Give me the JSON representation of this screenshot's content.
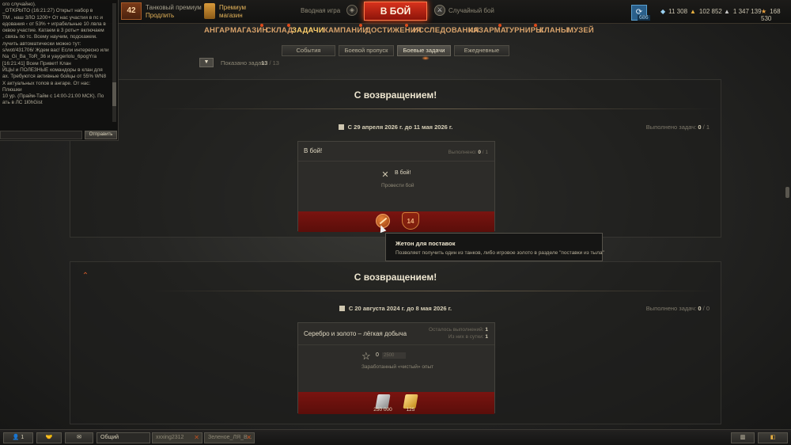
{
  "chat": {
    "lines": [
      "ого случайно).",
      "_OTKPbITO (16:21:27) Открыт набор в",
      "ТМ , наш ЗЛО 1200+ От нас участия в пс и",
      "едования ‹ от 53% + играбельные 10 лвла в",
      "оквое участие. Катаем в 3 роты+ включаем",
      ", связь по тс. Всему научим, подскажем.",
      "лучить автоматически можно тут:",
      "s/wot/431706/ Ждем вас! Если интересно или",
      "Na_Gi_Ba_ToR_36 и yaygerlolu_6pogYra",
      "[16:21:41] Всем Привет! Клан",
      "ЙЦЫ и ПОЛЕЗНЫЕ командоры в клан для",
      "ах. Требуются активные бойцы от 55% WN8",
      "X актуальных топов в ангаре. От нас: Плюшки",
      "10 ур. (Прайм-Тайм с 14:00-21:00 МСК). По",
      "ать в ЛС 1l0hGist"
    ],
    "send_label": "Отправить"
  },
  "topbar": {
    "level": "42",
    "premium_line1": "Танковый премиум",
    "premium_line2": "Продлить",
    "shop_line1": "Премиум",
    "shop_line2": "магазин",
    "mode_left": "Вводная игра",
    "battle_label": "В БОЙ",
    "mode_right": "Случайный бой",
    "garage_count": "686",
    "currencies": [
      {
        "icon": "bonds-icon",
        "value": "11 308"
      },
      {
        "icon": "gold-icon",
        "value": "102 852"
      },
      {
        "icon": "silver-icon",
        "value": "1 347 139"
      },
      {
        "icon": "free-xp-icon",
        "value": "168 530"
      }
    ]
  },
  "nav": {
    "items": [
      {
        "label": "АНГАР",
        "dot": false,
        "active": false
      },
      {
        "label": "МАГАЗИН",
        "dot": true,
        "active": false
      },
      {
        "label": "СКЛАД",
        "dot": true,
        "active": false
      },
      {
        "label": "ЗАДАЧИ",
        "dot": false,
        "active": true
      },
      {
        "label": "КАМПАНИИ",
        "dot": true,
        "active": false
      },
      {
        "label": "ДОСТИЖЕНИЯ",
        "dot": true,
        "active": false
      },
      {
        "label": "ИССЛЕДОВАНИЯ",
        "dot": false,
        "active": false
      },
      {
        "label": "КАЗАРМА",
        "dot": true,
        "active": false
      },
      {
        "label": "ТУРНИРЫ",
        "dot": true,
        "active": false
      },
      {
        "label": "КЛАНЫ",
        "dot": false,
        "active": false
      },
      {
        "label": "МУЗЕЙ",
        "dot": false,
        "active": false
      }
    ]
  },
  "subtabs": [
    {
      "label": "События",
      "active": false
    },
    {
      "label": "Боевой пропуск",
      "active": false
    },
    {
      "label": "Боевые задачи",
      "active": true
    },
    {
      "label": "Ежедневные",
      "active": false
    }
  ],
  "filter": {
    "shown_label": "Показано задач:",
    "shown_value": "13",
    "shown_total": "/ 13"
  },
  "section1": {
    "title": "С возвращением!",
    "dates": "С 29 апреля 2026 г. до 11 мая 2026 г.",
    "progress_label": "Выполнено задач:",
    "progress_done": "0",
    "progress_total": "/ 1",
    "card": {
      "title": "В бой!",
      "progress_label": "Выполнено:",
      "progress_done": "0",
      "progress_total": "/ 1",
      "condition_name": "В бой!",
      "condition_desc": "Провести бой",
      "reward_badge": "14"
    }
  },
  "section2": {
    "title": "С возвращением!",
    "dates": "С 20 августа 2024 г. до 8 мая 2026 г.",
    "progress_label": "Выполнено задач:",
    "progress_done": "0",
    "progress_total": "/ 0",
    "card": {
      "title": "Серебро и золото – лёгкая добыча",
      "remaining_label": "Осталось выполнений:",
      "remaining_value": "1",
      "perday_label": "Из них в сутки:",
      "perday_value": "1",
      "stat_current": "0",
      "stat_target": "2500",
      "condition_desc": "Заработанный «чистый» опыт",
      "reward_silver": "250 000",
      "reward_gold": "125"
    }
  },
  "tooltip": {
    "title": "Жетон для поставок",
    "desc": "Позволяет получить один из танков, либо игровое золото в разделе \"поставки из тыла\""
  },
  "bottombar": {
    "players_count": "1",
    "channel_general": "Общий",
    "channel_2": "xxxing2312",
    "channel_3": "Зеленое_ЛЯ_В..."
  }
}
